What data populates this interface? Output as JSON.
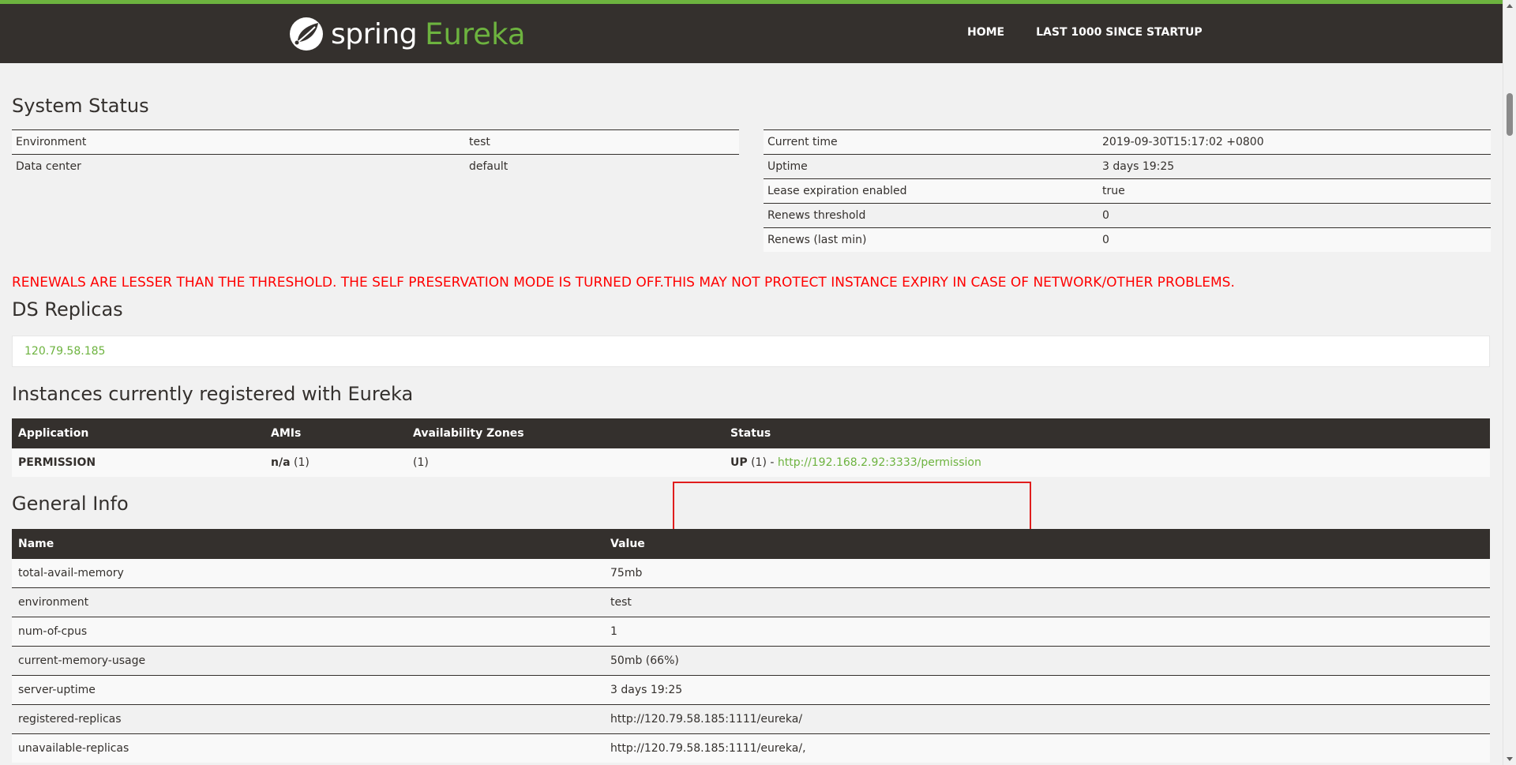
{
  "nav": {
    "brand_spring": "spring",
    "brand_eureka": "Eureka",
    "links": [
      "HOME",
      "LAST 1000 SINCE STARTUP"
    ]
  },
  "system_status": {
    "title": "System Status",
    "left": [
      {
        "label": "Environment",
        "value": "test"
      },
      {
        "label": "Data center",
        "value": "default"
      }
    ],
    "right": [
      {
        "label": "Current time",
        "value": "2019-09-30T15:17:02 +0800"
      },
      {
        "label": "Uptime",
        "value": "3 days 19:25"
      },
      {
        "label": "Lease expiration enabled",
        "value": "true"
      },
      {
        "label": "Renews threshold",
        "value": "0"
      },
      {
        "label": "Renews (last min)",
        "value": "0"
      }
    ]
  },
  "alert": "RENEWALS ARE LESSER THAN THE THRESHOLD. THE SELF PRESERVATION MODE IS TURNED OFF.THIS MAY NOT PROTECT INSTANCE EXPIRY IN CASE OF NETWORK/OTHER PROBLEMS.",
  "ds_replicas": {
    "title": "DS Replicas",
    "items": [
      "120.79.58.185"
    ]
  },
  "instances": {
    "title": "Instances currently registered with Eureka",
    "headers": [
      "Application",
      "AMIs",
      "Availability Zones",
      "Status"
    ],
    "rows": [
      {
        "application": "PERMISSION",
        "ami_value": "n/a",
        "ami_count": "(1)",
        "zones": "(1)",
        "status": "UP",
        "status_count": "(1) -",
        "status_link": "http://192.168.2.92:3333/permission"
      }
    ]
  },
  "general_info": {
    "title": "General Info",
    "headers": [
      "Name",
      "Value"
    ],
    "rows": [
      {
        "name": "total-avail-memory",
        "value": "75mb"
      },
      {
        "name": "environment",
        "value": "test"
      },
      {
        "name": "num-of-cpus",
        "value": "1"
      },
      {
        "name": "current-memory-usage",
        "value": "50mb (66%)"
      },
      {
        "name": "server-uptime",
        "value": "3 days 19:25"
      },
      {
        "name": "registered-replicas",
        "value": "http://120.79.58.185:1111/eureka/"
      },
      {
        "name": "unavailable-replicas",
        "value": "http://120.79.58.185:1111/eureka/,"
      }
    ]
  },
  "colors": {
    "nav_bg": "#34302d",
    "brand_green": "#6db33f",
    "alert_red": "#ff0000",
    "highlight_red": "#e01d1d"
  }
}
